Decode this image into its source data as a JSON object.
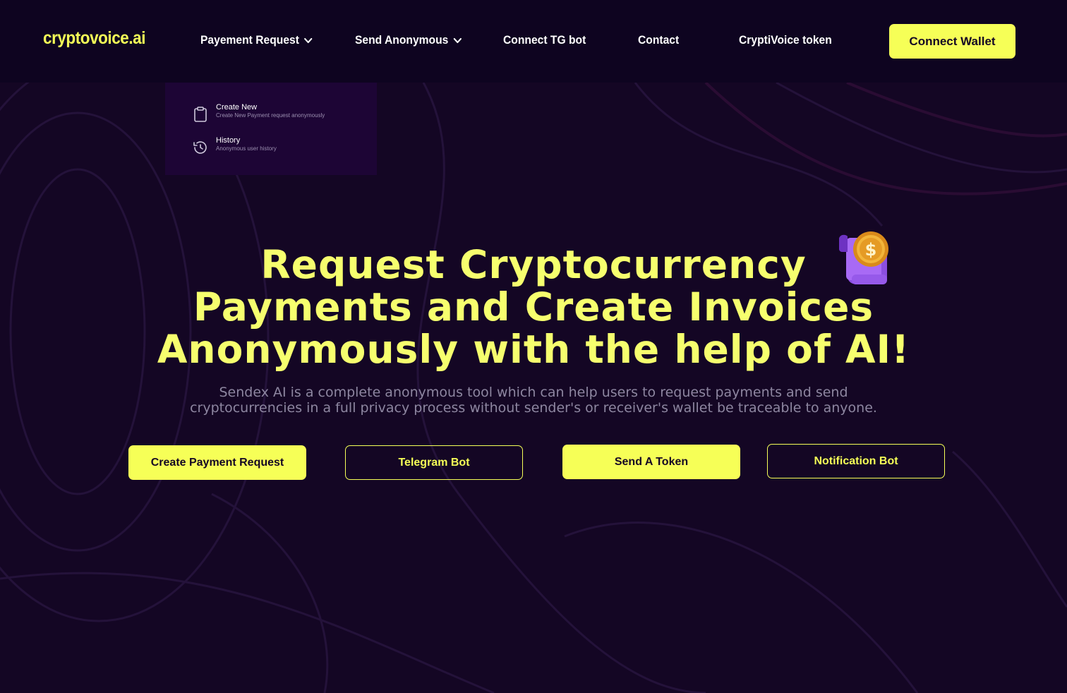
{
  "header": {
    "logo": "cryptovoice.ai",
    "nav": [
      {
        "label": "Payement Request",
        "has_dropdown": true
      },
      {
        "label": "Send Anonymous",
        "has_dropdown": true
      },
      {
        "label": "Connect TG bot",
        "has_dropdown": false
      },
      {
        "label": "Contact",
        "has_dropdown": false
      },
      {
        "label": "CryptiVoice token",
        "has_dropdown": false
      }
    ],
    "wallet_button": "Connect Wallet"
  },
  "dropdown": {
    "items": [
      {
        "title": "Create New",
        "subtitle": "Create New Payment request anonymously",
        "icon": "clipboard-icon"
      },
      {
        "title": "History",
        "subtitle": "Anonymous user history",
        "icon": "history-icon"
      }
    ]
  },
  "hero": {
    "title_lines": [
      "Request Cryptocurrency",
      "Payments and Create Invoices",
      "Anonymously with the help of AI!"
    ],
    "subtitle_lines": [
      "Sendex AI is a complete anonymous tool which can help users to request payments and send",
      "cryptocurrencies in a full privacy process without sender's or receiver's wallet be traceable to anyone."
    ],
    "buttons": [
      {
        "label": "Create Payment Request",
        "style": "solid"
      },
      {
        "label": "Telegram Bot",
        "style": "outline"
      },
      {
        "label": "Send A Token",
        "style": "solid"
      },
      {
        "label": "Notification Bot",
        "style": "outline"
      }
    ]
  },
  "colors": {
    "background": "#140624",
    "header": "#0e0420",
    "accent": "#f6ff57",
    "dropdown": "#1d0535"
  }
}
